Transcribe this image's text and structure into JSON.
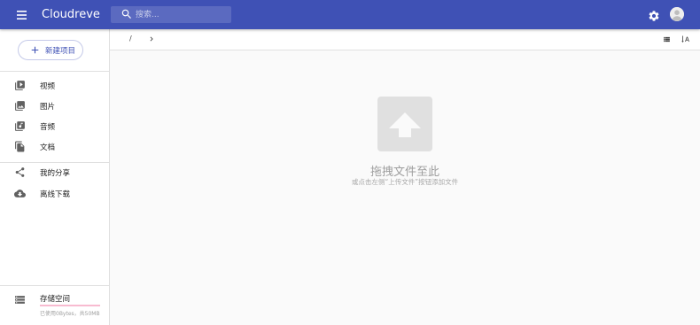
{
  "app": {
    "title": "Cloudreve"
  },
  "search": {
    "placeholder": "搜索..."
  },
  "sidebar": {
    "new_button": "新建项目",
    "items": [
      {
        "label": "视频",
        "icon": "video-library-icon"
      },
      {
        "label": "图片",
        "icon": "photo-library-icon"
      },
      {
        "label": "音频",
        "icon": "library-music-icon"
      },
      {
        "label": "文档",
        "icon": "file-copy-icon"
      },
      {
        "label": "我的分享",
        "icon": "share-icon"
      },
      {
        "label": "离线下载",
        "icon": "cloud-download-icon"
      }
    ],
    "storage": {
      "title": "存储空间",
      "detail": "已使用0Bytes，共50MB",
      "used_fraction": 0
    }
  },
  "pathbar": {
    "root": "/"
  },
  "empty": {
    "title": "拖拽文件至此",
    "hint": "或点击左侧“上传文件”按钮添加文件"
  },
  "colors": {
    "primary": "#3f51b5",
    "accent": "#e91e63"
  }
}
